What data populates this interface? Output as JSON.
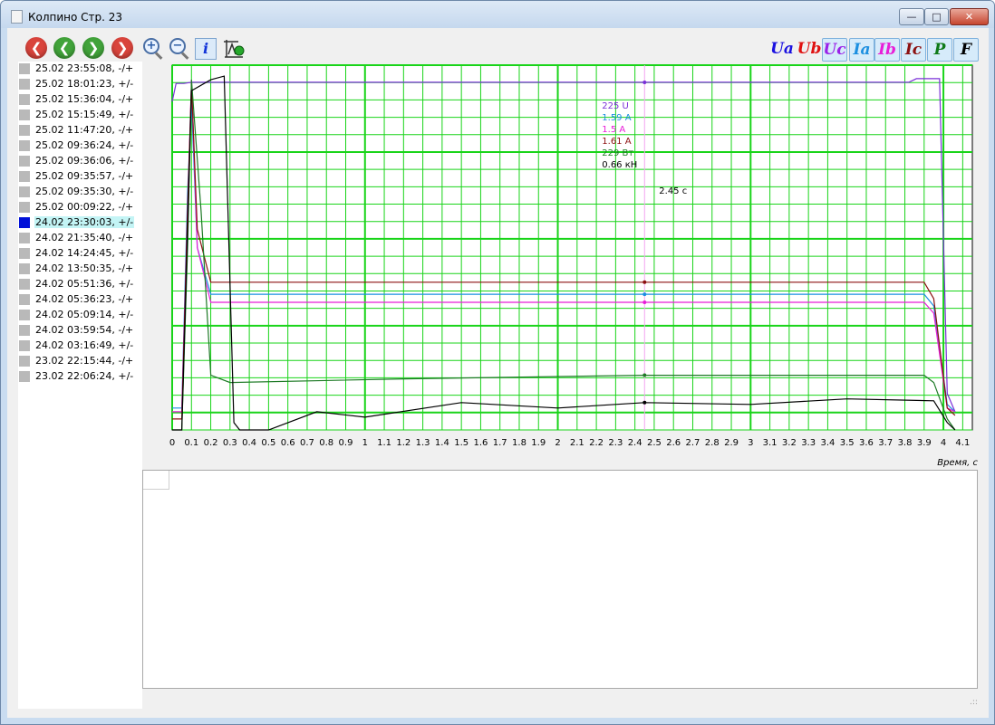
{
  "window": {
    "title": "Колпино Стр. 23"
  },
  "window_controls": {
    "minimize": "—",
    "maximize": "□",
    "close": "✕"
  },
  "toolbar": {
    "nav_buttons": [
      {
        "icon": "first-arrow-icon",
        "glyph": "❮",
        "color": "#d9443c"
      },
      {
        "icon": "prev-arrow-icon",
        "glyph": "❮",
        "color": "#41a33a"
      },
      {
        "icon": "next-arrow-icon",
        "glyph": "❯",
        "color": "#41a33a"
      },
      {
        "icon": "last-arrow-icon",
        "glyph": "❯",
        "color": "#d9443c"
      }
    ],
    "zoom_in_glyph": "+",
    "zoom_out_glyph": "−",
    "info_label": "i",
    "channels": [
      {
        "label": "Ua",
        "color": "#1a10e0",
        "active": false
      },
      {
        "label": "Ub",
        "color": "#e01010",
        "active": false
      },
      {
        "label": "Uc",
        "color": "#9a22e8",
        "active": true
      },
      {
        "label": "Ia",
        "color": "#1c8fe0",
        "active": true
      },
      {
        "label": "Ib",
        "color": "#e81ed8",
        "active": true
      },
      {
        "label": "Ic",
        "color": "#8c1010",
        "active": true
      },
      {
        "label": "P",
        "color": "#0f7a18",
        "active": true
      },
      {
        "label": "F",
        "color": "#000000",
        "active": true
      }
    ]
  },
  "records": [
    {
      "label": "25.02 23:55:08, -/+",
      "selected": false
    },
    {
      "label": "25.02 18:01:23, +/-",
      "selected": false
    },
    {
      "label": "25.02 15:36:04, -/+",
      "selected": false
    },
    {
      "label": "25.02 15:15:49, +/-",
      "selected": false
    },
    {
      "label": "25.02 11:47:20, -/+",
      "selected": false
    },
    {
      "label": "25.02 09:36:24, +/-",
      "selected": false
    },
    {
      "label": "25.02 09:36:06, +/-",
      "selected": false
    },
    {
      "label": "25.02 09:35:57, -/+",
      "selected": false
    },
    {
      "label": "25.02 09:35:30, +/-",
      "selected": false
    },
    {
      "label": "25.02 00:09:22, -/+",
      "selected": false
    },
    {
      "label": "24.02 23:30:03, +/-",
      "selected": true
    },
    {
      "label": "24.02 21:35:40, -/+",
      "selected": false
    },
    {
      "label": "24.02 14:24:45, +/-",
      "selected": false
    },
    {
      "label": "24.02 13:50:35, -/+",
      "selected": false
    },
    {
      "label": "24.02 05:51:36, +/-",
      "selected": false
    },
    {
      "label": "24.02 05:36:23, -/+",
      "selected": false
    },
    {
      "label": "24.02 05:09:14, +/-",
      "selected": false
    },
    {
      "label": "24.02 03:59:54, -/+",
      "selected": false
    },
    {
      "label": "24.02 03:16:49, +/-",
      "selected": false
    },
    {
      "label": "23.02 22:15:44, -/+",
      "selected": false
    },
    {
      "label": "23.02 22:06:24, +/-",
      "selected": false
    }
  ],
  "chart_data": {
    "type": "line",
    "xlabel": "Время, с",
    "xlim": [
      0,
      4.15
    ],
    "ylim": [
      0,
      1
    ],
    "grid": true,
    "x_ticks": [
      "0",
      "0.1",
      "0.2",
      "0.3",
      "0.4",
      "0.5",
      "0.6",
      "0.7",
      "0.8",
      "0.9",
      "1",
      "1.1",
      "1.2",
      "1.3",
      "1.4",
      "1.5",
      "1.6",
      "1.7",
      "1.8",
      "1.9",
      "2",
      "2.1",
      "2.2",
      "2.3",
      "2.4",
      "2.5",
      "2.6",
      "2.7",
      "2.8",
      "2.9",
      "3",
      "3.1",
      "3.2",
      "3.3",
      "3.4",
      "3.5",
      "3.6",
      "3.7",
      "3.8",
      "3.9",
      "4",
      "4.1"
    ],
    "cursor": {
      "x": 2.45,
      "label": "2.45 с"
    },
    "series": [
      {
        "channel": "Uc",
        "color": "#7a30d8",
        "x": [
          0,
          0.02,
          0.06,
          0.1,
          0.15,
          2.45,
          3.82,
          3.86,
          3.98,
          4.02,
          4.06
        ],
        "y": [
          0.9,
          0.95,
          0.95,
          0.953,
          0.953,
          0.953,
          0.953,
          0.963,
          0.963,
          0.1,
          0.05
        ],
        "cursor_value": "225 U"
      },
      {
        "channel": "Ia",
        "color": "#1c8fe0",
        "x": [
          0,
          0.05,
          0.08,
          0.1,
          0.13,
          0.2,
          2.45,
          3.9,
          3.95,
          4.02,
          4.06
        ],
        "y": [
          0.06,
          0.06,
          0.65,
          0.9,
          0.5,
          0.372,
          0.372,
          0.372,
          0.34,
          0.07,
          0.05
        ],
        "cursor_value": "1.59 A"
      },
      {
        "channel": "Ib",
        "color": "#e81ed8",
        "x": [
          0,
          0.05,
          0.08,
          0.1,
          0.13,
          0.2,
          2.45,
          3.9,
          3.95,
          4.02,
          4.06
        ],
        "y": [
          0.05,
          0.05,
          0.6,
          0.96,
          0.5,
          0.35,
          0.35,
          0.35,
          0.32,
          0.06,
          0.05
        ],
        "cursor_value": "1.5 A"
      },
      {
        "channel": "Ic",
        "color": "#8c1010",
        "x": [
          0,
          0.05,
          0.08,
          0.1,
          0.13,
          0.2,
          2.45,
          3.9,
          3.95,
          4.02,
          4.06
        ],
        "y": [
          0.03,
          0.03,
          0.6,
          0.95,
          0.55,
          0.405,
          0.405,
          0.405,
          0.36,
          0.06,
          0.04
        ],
        "cursor_value": "1.61 A"
      },
      {
        "channel": "P",
        "color": "#1e7a26",
        "x": [
          0,
          0.05,
          0.08,
          0.1,
          0.15,
          0.2,
          0.3,
          1.2,
          2.45,
          3.5,
          3.9,
          3.95,
          4.02,
          4.06
        ],
        "y": [
          0.0,
          0.0,
          0.5,
          0.96,
          0.6,
          0.15,
          0.13,
          0.14,
          0.15,
          0.15,
          0.15,
          0.13,
          0.03,
          0.0
        ],
        "cursor_value": "229 Вт"
      },
      {
        "channel": "F",
        "color": "#000000",
        "x": [
          0,
          0.05,
          0.08,
          0.1,
          0.2,
          0.27,
          0.32,
          0.35,
          0.5,
          0.75,
          1.0,
          1.5,
          2.0,
          2.45,
          3.0,
          3.5,
          3.95,
          4.02,
          4.06
        ],
        "y": [
          0.0,
          0.0,
          0.55,
          0.93,
          0.96,
          0.97,
          0.02,
          0.0,
          0.0,
          0.05,
          0.035,
          0.075,
          0.06,
          0.075,
          0.07,
          0.085,
          0.08,
          0.02,
          0.0
        ],
        "cursor_value": "0.66 кН"
      }
    ]
  }
}
